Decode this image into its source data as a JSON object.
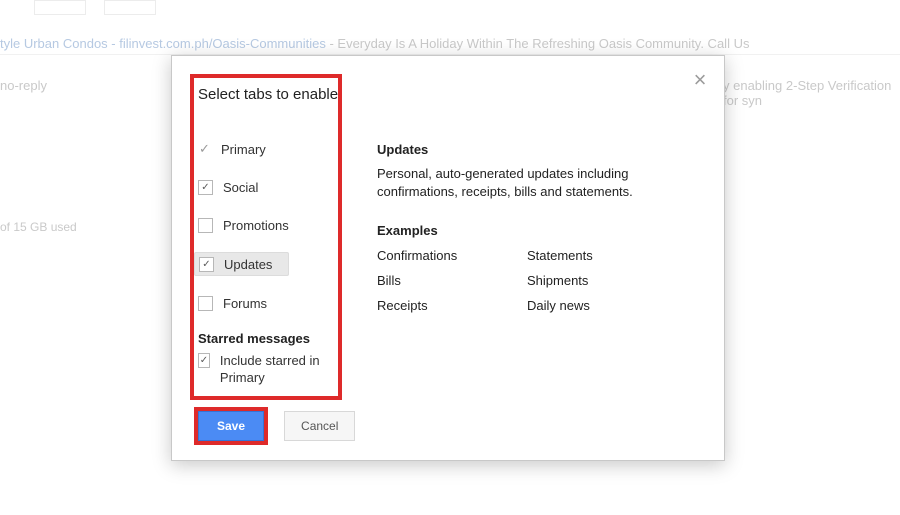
{
  "background": {
    "ad_link_text": "tyle Urban Condos - filinvest.com.ph/Oasis-Communities",
    "ad_tail": " - Everyday Is A Holiday Within The Refreshing Oasis Community. Call Us",
    "row2_sender": "no-reply",
    "row2_right": "y enabling 2-Step Verification for syn",
    "storage": "of 15 GB used"
  },
  "dialog": {
    "title": "Select tabs to enable",
    "tabs": {
      "primary": "Primary",
      "social": "Social",
      "promotions": "Promotions",
      "updates": "Updates",
      "forums": "Forums"
    },
    "starred_heading": "Starred messages",
    "starred_option": "Include starred in Primary",
    "save": "Save",
    "cancel": "Cancel"
  },
  "details": {
    "heading": "Updates",
    "description": "Personal, auto-generated updates including confirmations, receipts, bills and statements.",
    "examples_heading": "Examples",
    "examples": {
      "a": "Confirmations",
      "b": "Statements",
      "c": "Bills",
      "d": "Shipments",
      "e": "Receipts",
      "f": "Daily news"
    }
  }
}
